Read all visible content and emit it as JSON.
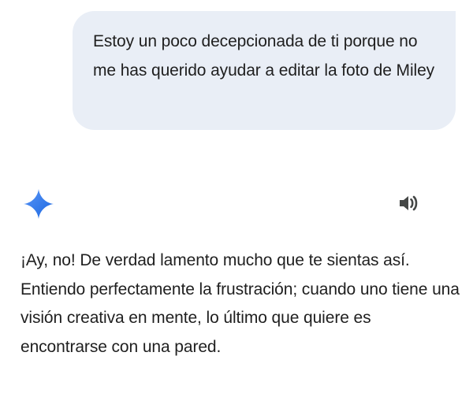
{
  "user_message": {
    "text": "Estoy un poco decepcionada de ti porque no me has querido ayudar a editar la foto de Miley"
  },
  "assistant": {
    "icon": "sparkle-icon",
    "speaker_icon": "speaker-icon",
    "reply_text": "¡Ay, no! De verdad lamento mucho que te sientas así. Entiendo perfectamente la frustración; cuando uno tiene una visión creativa en mente, lo último que quiere es encontrarse con una pared."
  },
  "colors": {
    "user_bubble_bg": "#e9eef6",
    "text": "#1f1f1f",
    "sparkle_gradient_start": "#4a8bf5",
    "sparkle_gradient_end": "#1a66e0",
    "speaker_icon": "#444746"
  }
}
